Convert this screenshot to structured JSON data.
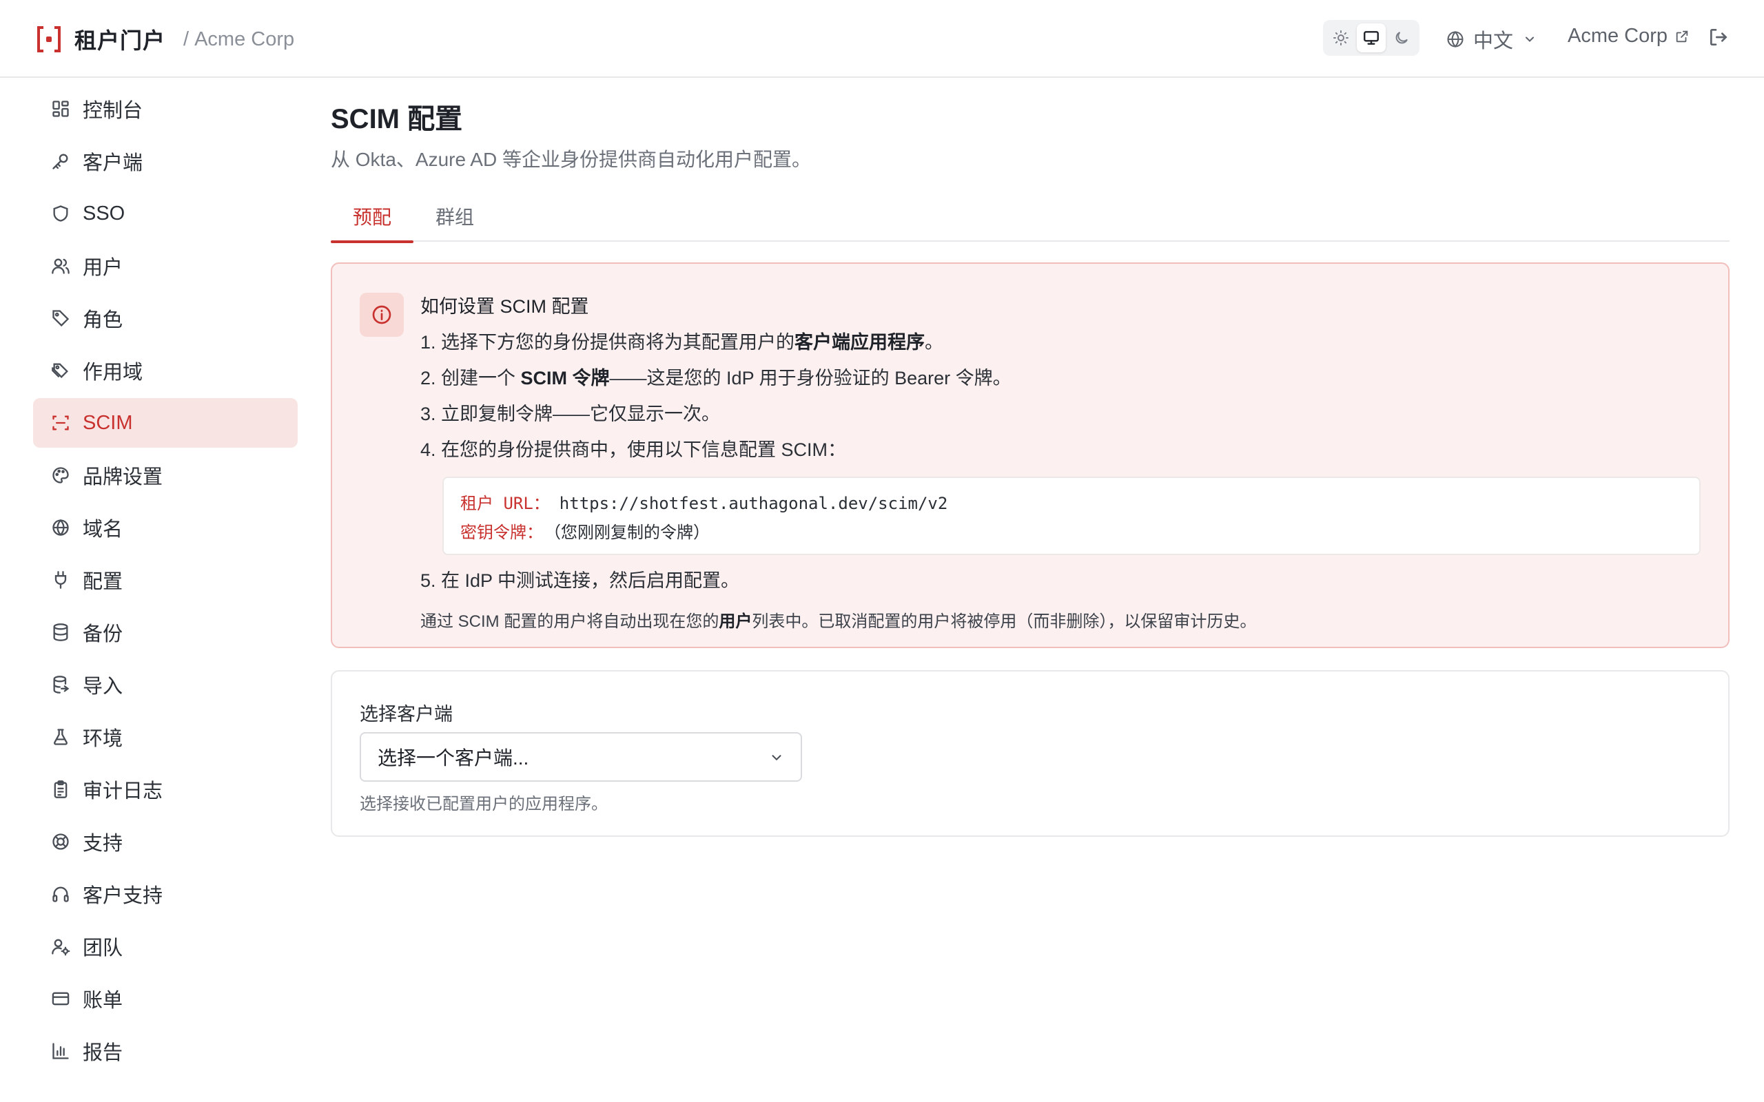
{
  "header": {
    "app_title": "租户门户",
    "separator": "/",
    "org_name": "Acme Corp",
    "language": "中文",
    "org_link": "Acme Corp",
    "icons": [
      "logo-icon",
      "sun-icon",
      "monitor-icon",
      "moon-icon",
      "globe-icon",
      "chevron-down-icon",
      "external-link-icon",
      "logout-icon"
    ]
  },
  "sidebar": {
    "items": [
      {
        "label": "控制台",
        "icon": "dashboard-icon"
      },
      {
        "label": "客户端",
        "icon": "key-icon"
      },
      {
        "label": "SSO",
        "icon": "shield-icon"
      },
      {
        "label": "用户",
        "icon": "users-icon"
      },
      {
        "label": "角色",
        "icon": "tag-icon"
      },
      {
        "label": "作用域",
        "icon": "tags-icon"
      },
      {
        "label": "SCIM",
        "icon": "scan-icon",
        "active": true
      },
      {
        "label": "品牌设置",
        "icon": "palette-icon"
      },
      {
        "label": "域名",
        "icon": "globe-icon"
      },
      {
        "label": "配置",
        "icon": "plug-icon"
      },
      {
        "label": "备份",
        "icon": "database-icon"
      },
      {
        "label": "导入",
        "icon": "database-import-icon"
      },
      {
        "label": "环境",
        "icon": "flask-icon"
      },
      {
        "label": "审计日志",
        "icon": "clipboard-icon"
      },
      {
        "label": "支持",
        "icon": "lifebuoy-icon"
      },
      {
        "label": "客户支持",
        "icon": "headset-icon"
      },
      {
        "label": "团队",
        "icon": "user-cog-icon"
      },
      {
        "label": "账单",
        "icon": "credit-card-icon"
      },
      {
        "label": "报告",
        "icon": "bar-chart-icon"
      }
    ]
  },
  "main": {
    "title": "SCIM 配置",
    "subtitle": "从 Okta、Azure AD 等企业身份提供商自动化用户配置。",
    "tabs": [
      {
        "label": "预配",
        "active": true
      },
      {
        "label": "群组",
        "active": false
      }
    ],
    "info": {
      "title": "如何设置 SCIM 配置",
      "step1_pre": "1. 选择下方您的身份提供商将为其配置用户的",
      "step1_bold": "客户端应用程序",
      "step1_post": "。",
      "step2_pre": "2. 创建一个 ",
      "step2_bold": "SCIM 令牌",
      "step2_post": "——这是您的 IdP 用于身份验证的 Bearer 令牌。",
      "step3": "3. 立即复制令牌——它仅显示一次。",
      "step4": "4. 在您的身份提供商中，使用以下信息配置 SCIM：",
      "code": {
        "url_key": "租户 URL：",
        "url_val": "https://shotfest.authagonal.dev/scim/v2",
        "token_key": "密钥令牌：",
        "token_val": "（您刚刚复制的令牌）"
      },
      "step5": "5. 在 IdP 中测试连接，然后启用配置。",
      "footnote_pre": "通过 SCIM 配置的用户将自动出现在您的",
      "footnote_bold": "用户",
      "footnote_post": "列表中。已取消配置的用户将被停用（而非删除），以保留审计历史。"
    },
    "select": {
      "label": "选择客户端",
      "value": "选择一个客户端...",
      "help": "选择接收已配置用户的应用程序。"
    }
  },
  "colors": {
    "accent": "#c8312e",
    "active_bg": "#f8e4e3",
    "info_bg": "#fcf1f0",
    "info_border": "#f2bebb"
  }
}
